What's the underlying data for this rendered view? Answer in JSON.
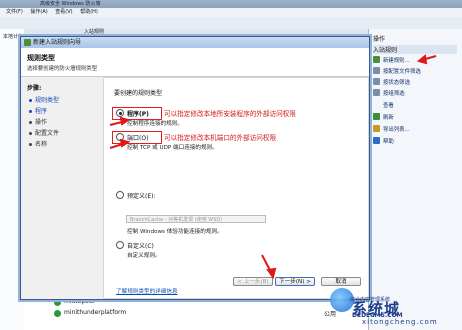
{
  "background_window": {
    "title_fragment": "高级安全 Windows 防火墙",
    "menu": [
      "文件(F)",
      "操作(A)",
      "查看(V)",
      "帮助(H)"
    ],
    "tree_label": "本地计算机 上的高级安全 Win",
    "center_header": "入站规则",
    "actions": {
      "head": "操作",
      "section": "入站规则",
      "items": [
        "新建规则...",
        "按配置文件筛选",
        "按状态筛选",
        "按组筛选",
        "查看",
        "刷新",
        "导出列表...",
        "帮助"
      ]
    },
    "bottom_rows": [
      {
        "name": "miutopost",
        "value": ""
      },
      {
        "name": "minithunderplatform",
        "value": "公用"
      }
    ]
  },
  "dialog": {
    "title": "新建入站规则向导",
    "header_title": "规则类型",
    "header_subtitle": "选择要创建的防火墙规则类型",
    "steps_label": "步骤:",
    "steps": [
      "规则类型",
      "程序",
      "操作",
      "配置文件",
      "名称"
    ],
    "question": "要创建的规则类型",
    "options": [
      {
        "label": "程序(P)",
        "desc": "控制程序连接的规则。",
        "checked": true
      },
      {
        "label": "端口(O)",
        "desc": "控制 TCP 或 UDP 端口连接的规则。",
        "checked": false
      },
      {
        "label": "预定义(E):",
        "desc": "控制 Windows 体验功能连接的规则。",
        "checked": false
      },
      {
        "label": "自定义(C)",
        "desc": "自定义规则。",
        "checked": false
      }
    ],
    "predefined_value": "BranchCache - 对等机发现 (使用 WSD)",
    "annotation_program": "可以指定修改本地所安装程序的外部访问权限",
    "annotation_port": "可以指定修改本机端口的外部访问权限",
    "learn_link": "了解规则类型的详细信息",
    "buttons": {
      "back": "< 上一步(B)",
      "next": "下一步(N) >",
      "cancel": "取消"
    }
  },
  "watermark": {
    "main": "系统城",
    "secondary": "综合内容管理系统",
    "url": "DEDECMS.COM",
    "site": "xitongcheng.com"
  },
  "colors": {
    "annotation": "#e11818",
    "link": "#0b4fb3",
    "step_current": "#1b49b4"
  }
}
